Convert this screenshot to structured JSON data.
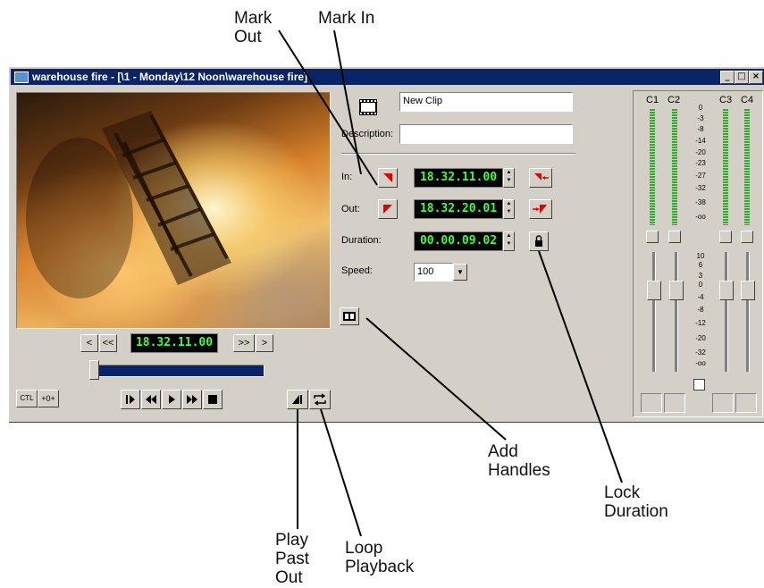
{
  "callouts": {
    "mark_out": [
      "Mark",
      "Out"
    ],
    "mark_in": "Mark In",
    "add_handles": [
      "Add",
      "Handles"
    ],
    "lock_duration": [
      "Lock",
      "Duration"
    ],
    "play_past_out": [
      "Play",
      "Past",
      "Out"
    ],
    "loop_playback": [
      "Loop",
      "Playback"
    ]
  },
  "window": {
    "title": "warehouse fire - [\\1 - Monday\\12 Noon\\warehouse fire]",
    "min_label": "_",
    "max_label": "□",
    "close_label": "×"
  },
  "player": {
    "timecode": "18.32.11.00",
    "prev_frame": "<",
    "rewind": "<<",
    "fast_fwd": ">>",
    "next_frame": ">",
    "ctl_label": "CTL",
    "zero_label": "+0+",
    "progress": 0.0
  },
  "clip": {
    "name": "New Clip",
    "description_label": "Description:",
    "description_value": "",
    "in_label": "In:",
    "in_tc": "18.32.11.00",
    "out_label": "Out:",
    "out_tc": "18.32.20.01",
    "duration_label": "Duration:",
    "duration_tc": "00.00.09.02",
    "speed_label": "Speed:",
    "speed_value": "100"
  },
  "audio": {
    "channels": [
      "C1",
      "C2",
      "C3",
      "C4"
    ],
    "meter_scale": [
      "0",
      "-3",
      "-8",
      "-14",
      "-20",
      "-23",
      "-27",
      "-32",
      "-38",
      "-oo"
    ],
    "fader_scale": [
      "10",
      "6",
      "3",
      "0",
      "-4",
      "-8",
      "-12",
      "-20",
      "-32",
      "-oo"
    ]
  },
  "colors": {
    "titlebar": "#0a246a",
    "timecode_text": "#3cff3c",
    "mark_red": "#e00000",
    "meter_green": "#2fae2f"
  }
}
